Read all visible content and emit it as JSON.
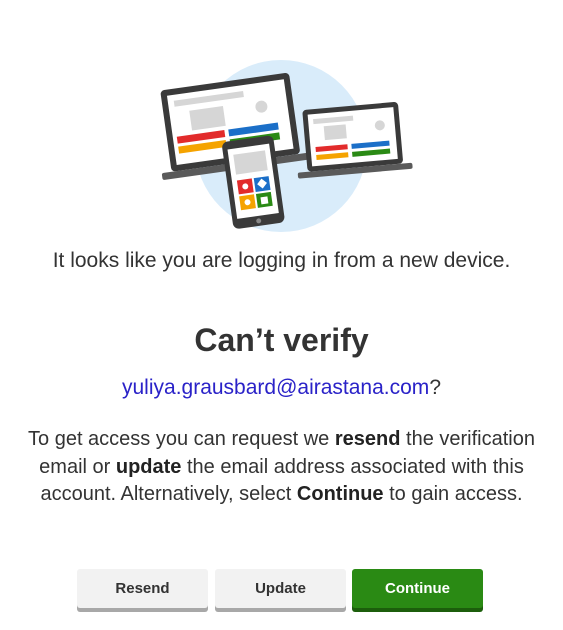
{
  "intro_text": "It looks like you are logging in from a new device.",
  "title": "Can’t verify",
  "email": {
    "address": "yuliya.grausbard@airastana.com",
    "suffix": "?"
  },
  "description": {
    "part1": "To get access you can request we ",
    "bold1": "resend",
    "part2": " the verification email or ",
    "bold2": "update",
    "part3": " the email address associated with this account. Alternatively, select ",
    "bold3": "Continue",
    "part4": " to gain access."
  },
  "buttons": {
    "resend": "Resend",
    "update": "Update",
    "continue": "Continue"
  },
  "colors": {
    "primary_button": "#2a8a14",
    "secondary_button": "#f2f2f2",
    "email_link": "#2a22c8",
    "illustration_circle": "#d9ecfa"
  }
}
